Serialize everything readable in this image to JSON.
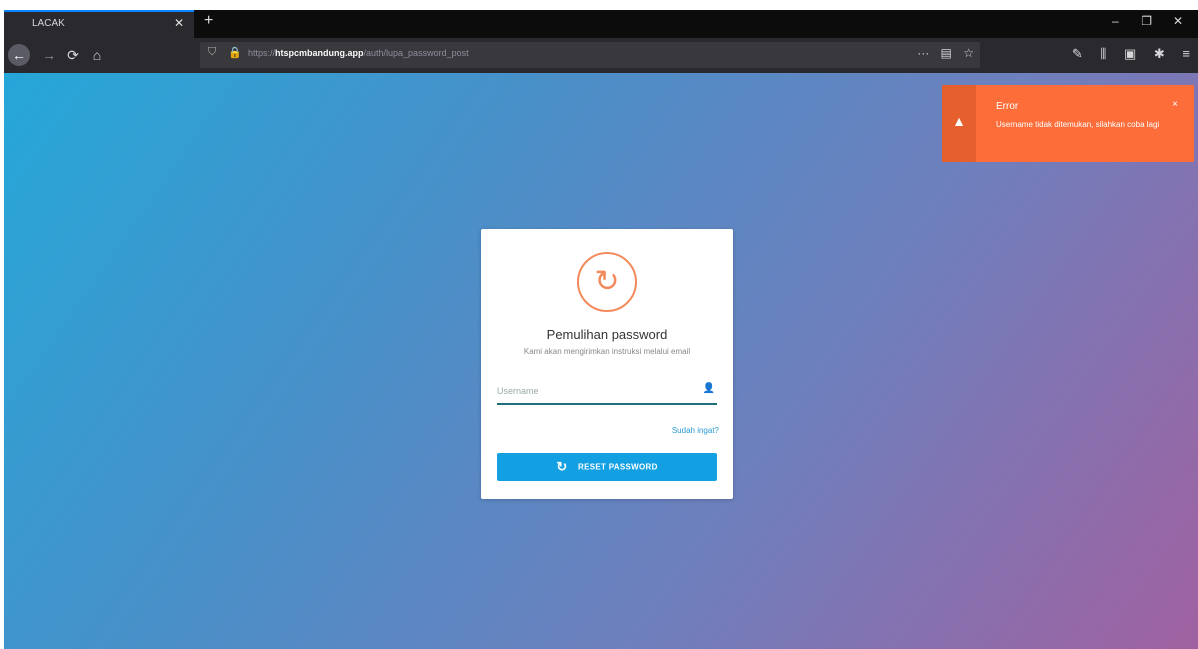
{
  "browser": {
    "tab_title": "LACAK",
    "tab_close": "✕",
    "new_tab": "+",
    "window_controls": {
      "minimize": "–",
      "restore": "❐",
      "close": "✕"
    },
    "nav": {
      "back": "←",
      "forward": "→",
      "reload": "⟳",
      "home": "⌂"
    },
    "url": {
      "prefix": "https://",
      "domain": "htspcmbandung.app",
      "path": "/auth/lupa_password_post"
    },
    "url_actions": {
      "more": "···",
      "reader": "▤",
      "bookmark": "☆"
    },
    "toolbar": {
      "tools": "✎",
      "library": "⫼",
      "sidebar": "▣",
      "extension": "✱",
      "menu": "≡"
    }
  },
  "card": {
    "title": "Pemulihan password",
    "subtitle": "Kami akan mengirimkan instruksi melalui email",
    "username_placeholder": "Username",
    "user_icon": "👤",
    "remember_link": "Sudah ingat?",
    "reset_button_label": "RESET PASSWORD",
    "reset_icon": "↻"
  },
  "toast": {
    "title": "Error",
    "message": "Username tidak ditemukan, silahkan coba lagi",
    "warning_icon": "▲",
    "close": "×"
  },
  "colors": {
    "accent": "#13a0e3",
    "toast": "#fc6d3a",
    "reset_icon": "#f28a5c"
  }
}
